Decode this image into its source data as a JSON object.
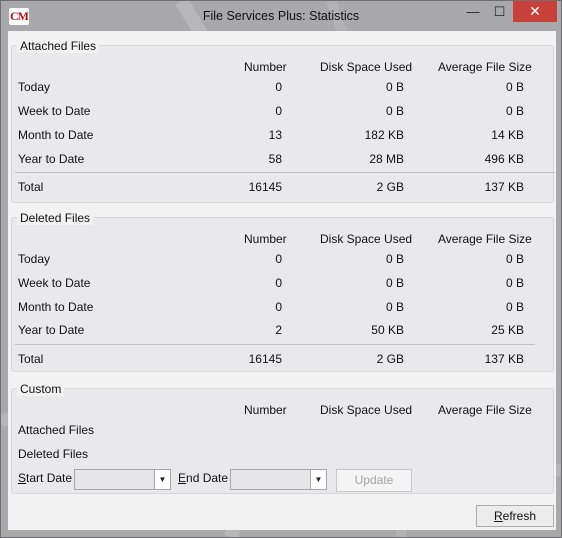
{
  "window": {
    "title": "File Services Plus: Statistics",
    "icon_text": "CM",
    "minimize_glyph": "—",
    "maximize_glyph": "☐",
    "close_glyph": "✕"
  },
  "columns": {
    "number": "Number",
    "disk_space": "Disk Space Used",
    "avg_size": "Average File Size"
  },
  "attached": {
    "title": "Attached Files",
    "rows": [
      {
        "label": "Today",
        "number": "0",
        "disk": "0 B",
        "avg": "0 B"
      },
      {
        "label": "Week to Date",
        "number": "0",
        "disk": "0 B",
        "avg": "0 B"
      },
      {
        "label": "Month to Date",
        "number": "13",
        "disk": "182 KB",
        "avg": "14 KB"
      },
      {
        "label": "Year to Date",
        "number": "58",
        "disk": "28 MB",
        "avg": "496 KB"
      }
    ],
    "total": {
      "label": "Total",
      "number": "16145",
      "disk": "2 GB",
      "avg": "137 KB"
    }
  },
  "deleted": {
    "title": "Deleted Files",
    "rows": [
      {
        "label": "Today",
        "number": "0",
        "disk": "0 B",
        "avg": "0 B"
      },
      {
        "label": "Week to Date",
        "number": "0",
        "disk": "0 B",
        "avg": "0 B"
      },
      {
        "label": "Month to Date",
        "number": "0",
        "disk": "0 B",
        "avg": "0 B"
      },
      {
        "label": "Year to Date",
        "number": "2",
        "disk": "50 KB",
        "avg": "25 KB"
      }
    ],
    "total": {
      "label": "Total",
      "number": "16145",
      "disk": "2 GB",
      "avg": "137 KB"
    }
  },
  "custom": {
    "title": "Custom",
    "attached_label": "Attached Files",
    "deleted_label": "Deleted Files",
    "start_date_prefix": "S",
    "start_date_rest": "tart Date",
    "end_date_prefix": "E",
    "end_date_rest": "nd Date",
    "start_date_value": "",
    "end_date_value": "",
    "update_label": "Update"
  },
  "refresh_prefix": "R",
  "refresh_rest": "efresh"
}
